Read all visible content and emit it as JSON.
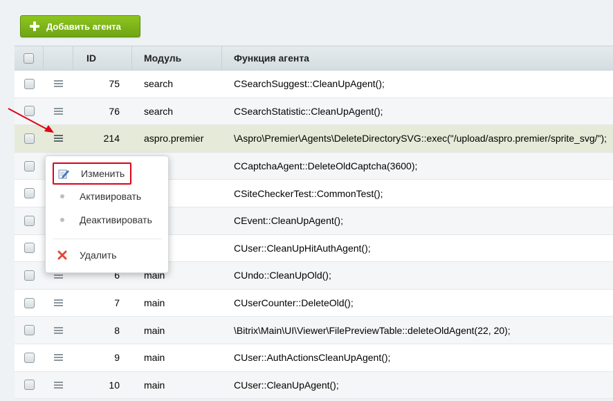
{
  "toolbar": {
    "add_label": "Добавить агента"
  },
  "grid": {
    "columns": {
      "id": "ID",
      "module": "Модуль",
      "function": "Функция агента"
    },
    "rows": [
      {
        "id": "75",
        "module": "search",
        "function": "CSearchSuggest::CleanUpAgent();"
      },
      {
        "id": "76",
        "module": "search",
        "function": "CSearchStatistic::CleanUpAgent();"
      },
      {
        "id": "214",
        "module": "aspro.premier",
        "function": "\\Aspro\\Premier\\Agents\\DeleteDirectorySVG::exec(\"/upload/aspro.premier/sprite_svg/\");"
      },
      {
        "id": "",
        "module": "",
        "function": "CCaptchaAgent::DeleteOldCaptcha(3600);"
      },
      {
        "id": "",
        "module": "",
        "function": "CSiteCheckerTest::CommonTest();"
      },
      {
        "id": "",
        "module": "",
        "function": "CEvent::CleanUpAgent();"
      },
      {
        "id": "",
        "module": "",
        "function": "CUser::CleanUpHitAuthAgent();"
      },
      {
        "id": "6",
        "module": "main",
        "function": "CUndo::CleanUpOld();"
      },
      {
        "id": "7",
        "module": "main",
        "function": "CUserCounter::DeleteOld();"
      },
      {
        "id": "8",
        "module": "main",
        "function": "\\Bitrix\\Main\\UI\\Viewer\\FilePreviewTable::deleteOldAgent(22, 20);"
      },
      {
        "id": "9",
        "module": "main",
        "function": "CUser::AuthActionsCleanUpAgent();"
      },
      {
        "id": "10",
        "module": "main",
        "function": "CUser::CleanUpAgent();"
      }
    ]
  },
  "context_menu": {
    "edit": "Изменить",
    "activate": "Активировать",
    "deactivate": "Деактивировать",
    "delete": "Удалить"
  },
  "colors": {
    "accent_green": "#7ab317",
    "highlight_row": "#e6ead8",
    "annotation_red": "#e0001a"
  }
}
